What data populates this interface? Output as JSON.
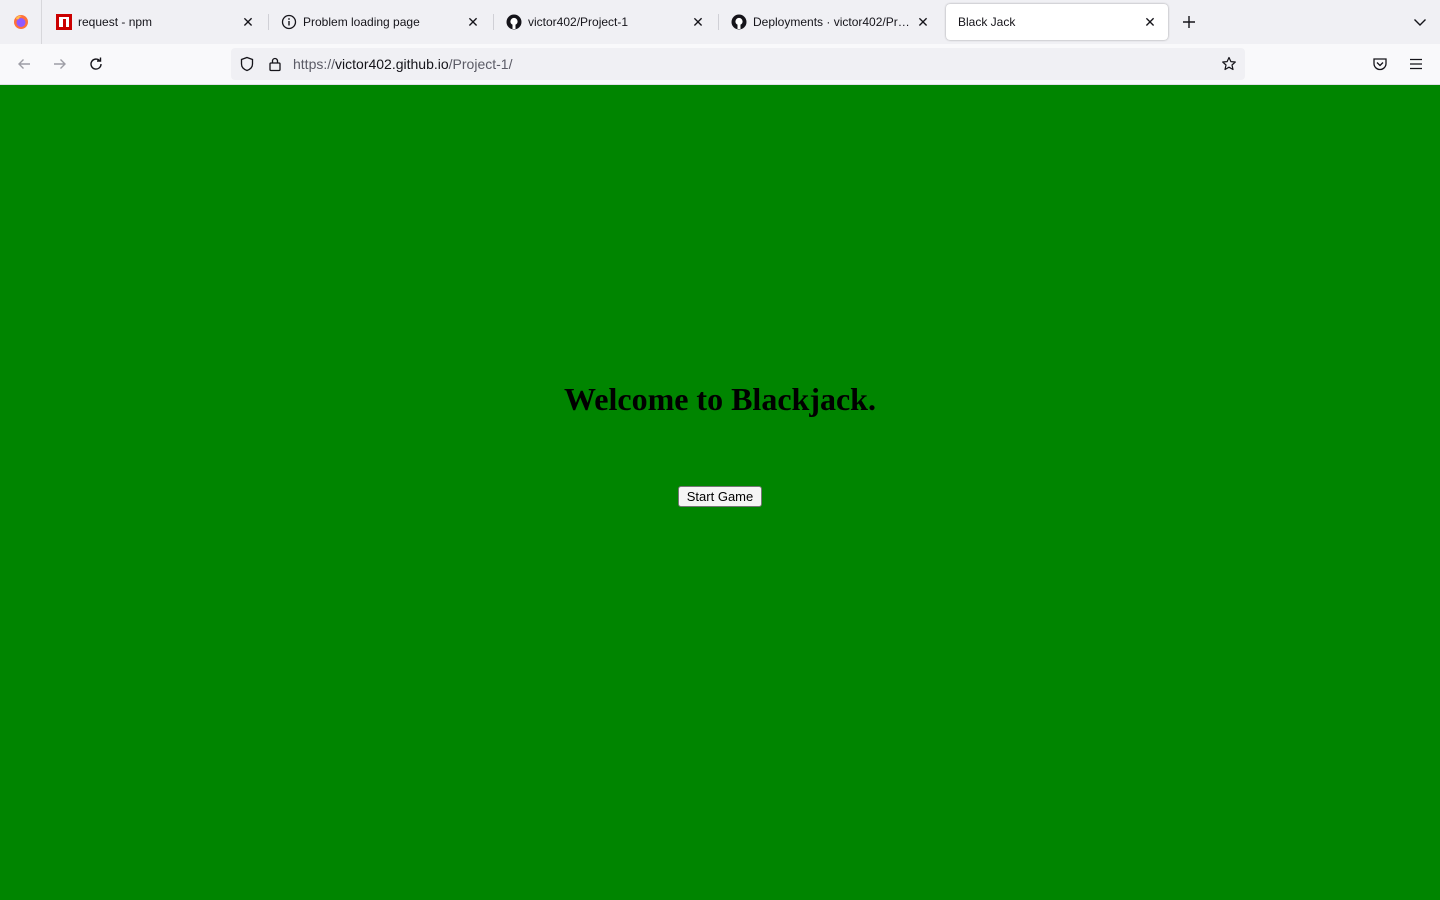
{
  "browser": {
    "tabs": [
      {
        "label": "request - npm",
        "icon": "npm-icon",
        "active": false
      },
      {
        "label": "Problem loading page",
        "icon": "info-icon",
        "active": false
      },
      {
        "label": "victor402/Project-1",
        "icon": "github-icon",
        "active": false
      },
      {
        "label": "Deployments · victor402/Project-1",
        "icon": "github-icon",
        "active": false
      },
      {
        "label": "Black Jack",
        "icon": "",
        "active": true
      }
    ],
    "url": {
      "scheme": "https://",
      "host": "victor402.github.io",
      "path": "/Project-1/"
    }
  },
  "page": {
    "heading": "Welcome to Blackjack.",
    "start_button": "Start Game",
    "background_color": "#008500"
  }
}
